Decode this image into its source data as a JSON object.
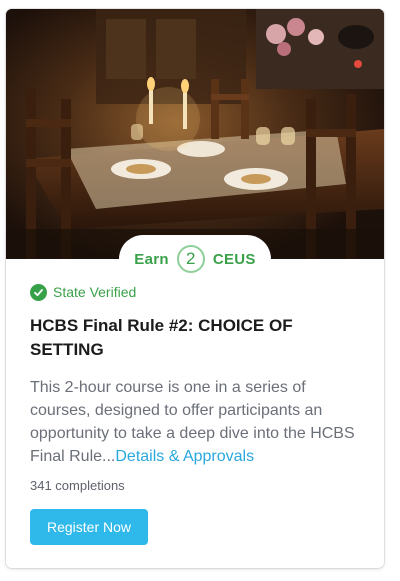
{
  "card": {
    "image_subject": "dining-table-photo",
    "earn": {
      "prefix": "Earn",
      "number": "2",
      "suffix": "CEUS"
    },
    "verified_label": "State Verified",
    "title": "HCBS Final Rule #2: CHOICE OF SETTING",
    "description": "This 2-hour course is one in a series of courses, designed to offer participants an opportunity to take a deep dive into the HCBS Final Rule...",
    "details_link": "Details & Approvals",
    "completions": "341 completions",
    "register_label": "Register Now"
  },
  "colors": {
    "accent_green": "#3aa14a",
    "link_blue": "#29a8e0",
    "button_blue": "#2fb9ea"
  }
}
